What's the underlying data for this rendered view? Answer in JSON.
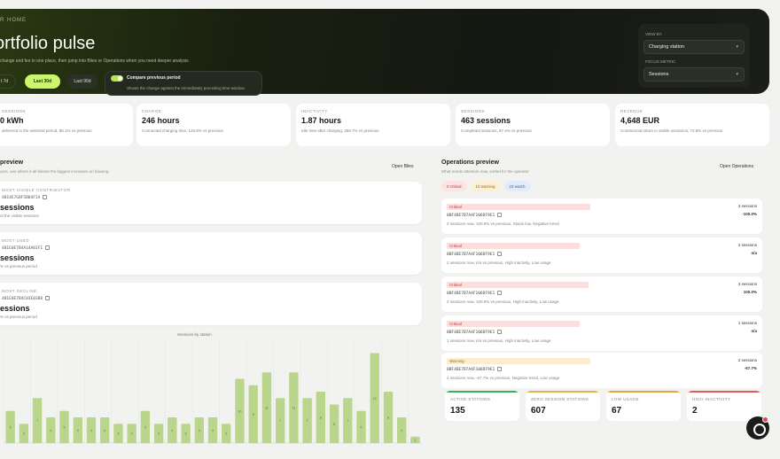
{
  "hero": {
    "eyebrow": "R HOME",
    "title": "ortfolio pulse",
    "subtitle": "change and fee in one place, then jump into Blies or Operations when you need deeper analysis",
    "range_chips": [
      "t 7d",
      "Last 30d",
      "Last 90d"
    ],
    "compare_title": "Compare previous period",
    "compare_desc": "Shows the change against the immediately preceding time window.",
    "filter_label_1": "VIEW BY",
    "filter_value_1": "Charging station",
    "filter_label_2": "FOCUS METRIC",
    "filter_value_2": "Sessions"
  },
  "kpis": [
    {
      "label": "SESSIONS",
      "value": "0 kWh",
      "note": "delivered in the selected period, 86.1% vs previous"
    },
    {
      "label": "CHARGE",
      "value": "246 hours",
      "note": "Connected charging time, 120.8% vs previous"
    },
    {
      "label": "INACTIVITY",
      "value": "1.87 hours",
      "note": "Idle time after charging, 359.7% vs previous"
    },
    {
      "label": "SESSIONS",
      "value": "463 sessions",
      "note": "Completed sessions, 97.4% vs previous"
    },
    {
      "label": "REVENUE",
      "value": "4,648 EUR",
      "note": "Commercial return in visible scenarios, 72.8% vs previous"
    }
  ],
  "preview": {
    "title": "preview",
    "desc": "ures, see where it all bleeds the biggest increases on blowing",
    "link": "Open Blies",
    "cards": [
      {
        "eyebrow": "MOST VISIBLE CONTRIBUTOR",
        "id": "4B14E7G8F5B04F1A",
        "value": "sessions",
        "note": "of the visible sessions"
      },
      {
        "eyebrow": "MOST USED",
        "id": "4B1E0E7B4A14A01F1",
        "value": "sessions",
        "note": "% vs previous period"
      },
      {
        "eyebrow": "MOST DECLINE",
        "id": "4B1E0E7B4C03E03B8",
        "value": "essions",
        "note": "% vs previous period"
      }
    ],
    "chart_title": "Sessions by station"
  },
  "operations": {
    "title": "Operations preview",
    "desc": "What needs attention now, sorted for the operator",
    "link": "Open Operations",
    "pills": [
      "0 critical",
      "10 warning",
      "23 watch"
    ],
    "rows": [
      {
        "tag": "Critical",
        "severity": "critical",
        "id": "0BF4BE7B7A4F106DF9E1",
        "detail": "3 sessions now, 100.0% vs previous, Stasis low, Negative trend",
        "sessions": "3 sessions",
        "pct": "-100.0%"
      },
      {
        "tag": "Critical",
        "severity": "critical",
        "id": "0BF4BE7B7A4F106DF9E1",
        "detail": "2 sessions now, n/a vs previous, High inactivity, Low usage",
        "sessions": "2 sessions",
        "pct": "n/a"
      },
      {
        "tag": "Critical",
        "severity": "critical",
        "id": "0BF4BE7B7A4F106DF9E1",
        "detail": "3 sessions now, 100.0% vs previous, High inactivity, Low usage",
        "sessions": "3 sessions",
        "pct": "100.0%"
      },
      {
        "tag": "Critical",
        "severity": "critical",
        "id": "0BF4BE7B7A4F106DF9E1",
        "detail": "1 sessions now, n/a vs previous, High inactivity, Low usage",
        "sessions": "1 sessions",
        "pct": "n/a"
      },
      {
        "tag": "Warning",
        "severity": "warning",
        "id": "0BF4BE7B7A4F106DF9E1",
        "detail": "2 sessions now, -67.7% vs previous, Negative trend, Low usage",
        "sessions": "2 sessions",
        "pct": "-67.7%"
      }
    ]
  },
  "bottom_stats": [
    {
      "label": "ACTIVE STATIONS",
      "value": "135",
      "color": "#3fae5a"
    },
    {
      "label": "ZERO SESSION STATIONS",
      "value": "607",
      "color": "#d8b84a"
    },
    {
      "label": "LOW USAGE",
      "value": "67",
      "color": "#e3a43d"
    },
    {
      "label": "HIGH INACTIVITY",
      "value": "2",
      "color": "#e05a5a"
    }
  ],
  "chart_data": {
    "type": "bar",
    "title": "Sessions by station",
    "values": [
      5,
      3,
      7,
      4,
      5,
      4,
      4,
      4,
      3,
      3,
      5,
      3,
      4,
      3,
      4,
      4,
      3,
      10,
      9,
      11,
      7,
      11,
      7,
      8,
      6,
      7,
      5,
      14,
      8,
      4,
      1
    ],
    "bar_color": "#b9d68c",
    "ylim": [
      0,
      16
    ]
  }
}
